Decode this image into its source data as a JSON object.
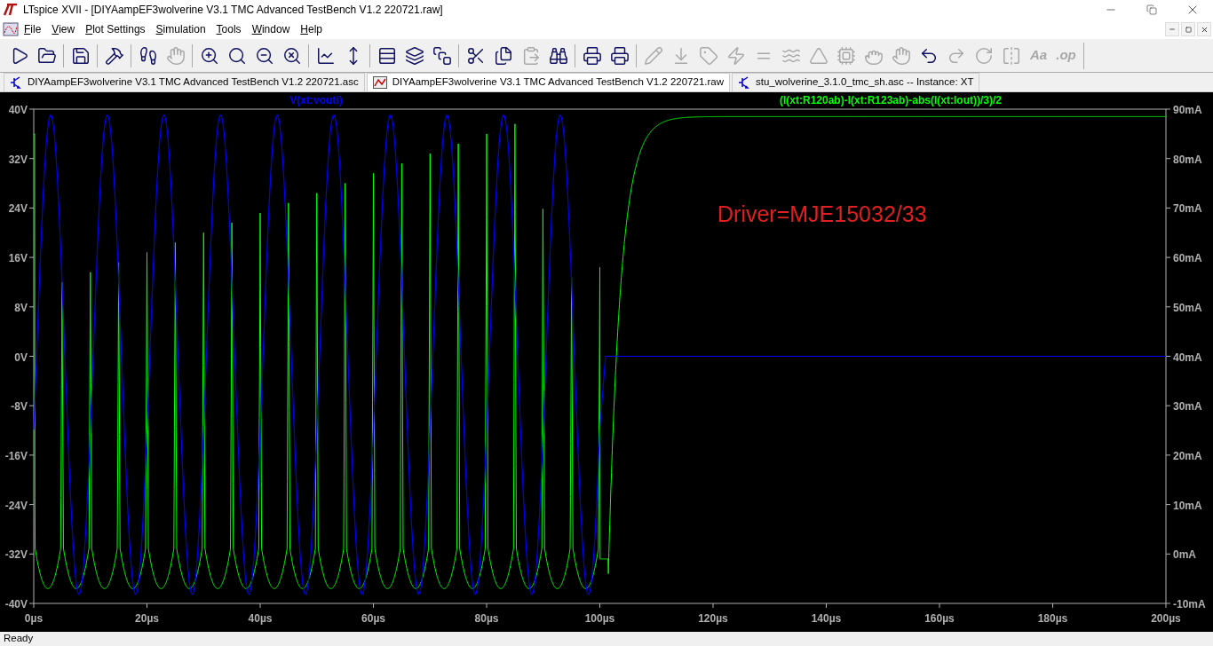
{
  "window": {
    "title": "LTspice XVII - [DIYAampEF3wolverine V3.1 TMC Advanced TestBench V1.2 220721.raw]"
  },
  "menu": [
    "File",
    "View",
    "Plot Settings",
    "Simulation",
    "Tools",
    "Window",
    "Help"
  ],
  "toolbar": [
    {
      "disabled": false
    },
    {
      "disabled": false
    },
    {
      "disabled": false
    },
    {
      "disabled": false
    },
    {
      "disabled": false
    },
    {
      "disabled": true
    },
    {
      "disabled": false
    },
    {
      "disabled": false
    },
    {
      "disabled": false
    },
    {
      "disabled": false
    },
    {
      "disabled": false
    },
    {
      "disabled": false
    },
    {
      "disabled": false
    },
    {
      "disabled": false
    },
    {
      "disabled": false
    },
    {
      "disabled": false
    },
    {
      "disabled": false
    },
    {
      "disabled": true
    },
    {
      "disabled": false
    },
    {
      "disabled": false
    },
    {
      "disabled": false
    },
    {
      "disabled": true
    },
    {
      "disabled": true
    },
    {
      "disabled": true
    },
    {
      "disabled": true
    },
    {
      "disabled": true
    },
    {
      "disabled": true
    },
    {
      "disabled": true
    },
    {
      "disabled": true
    },
    {
      "disabled": true
    },
    {
      "disabled": true
    },
    {
      "disabled": false
    },
    {
      "disabled": true
    },
    {
      "disabled": true
    },
    {
      "disabled": true
    },
    {
      "disabled": true,
      "label": "Aa"
    },
    {
      "disabled": true,
      "label": ".op"
    }
  ],
  "tabs": [
    {
      "label": "DIYAampEF3wolverine V3.1 TMC Advanced TestBench V1.2 220721.asc",
      "kind": "schematic",
      "selected": false
    },
    {
      "label": "DIYAampEF3wolverine V3.1 TMC Advanced TestBench V1.2 220721.raw",
      "kind": "waveform",
      "selected": true
    },
    {
      "label": "stu_wolverine_3.1.0_tmc_sh.asc -- Instance: XT",
      "kind": "schematic",
      "selected": false
    }
  ],
  "plot": {
    "traces": [
      {
        "name": "V(xt:vouti)",
        "color": "#0000ff"
      },
      {
        "name": "(I(xt:R120ab)-I(xt:R123ab)-abs(I(xt:Iout))/3)/2",
        "color": "#00ff00"
      }
    ],
    "left_ticks": [
      "40V",
      "32V",
      "24V",
      "16V",
      "8V",
      "0V",
      "-8V",
      "-16V",
      "-24V",
      "-32V",
      "-40V"
    ],
    "right_ticks": [
      "90mA",
      "80mA",
      "70mA",
      "60mA",
      "50mA",
      "40mA",
      "30mA",
      "20mA",
      "10mA",
      "0mA",
      "-10mA"
    ],
    "x_ticks": [
      "0µs",
      "20µs",
      "40µs",
      "60µs",
      "80µs",
      "100µs",
      "120µs",
      "140µs",
      "160µs",
      "180µs",
      "200µs"
    ],
    "annotation": "Driver=MJE15032/33"
  },
  "status_bar": "Ready"
}
